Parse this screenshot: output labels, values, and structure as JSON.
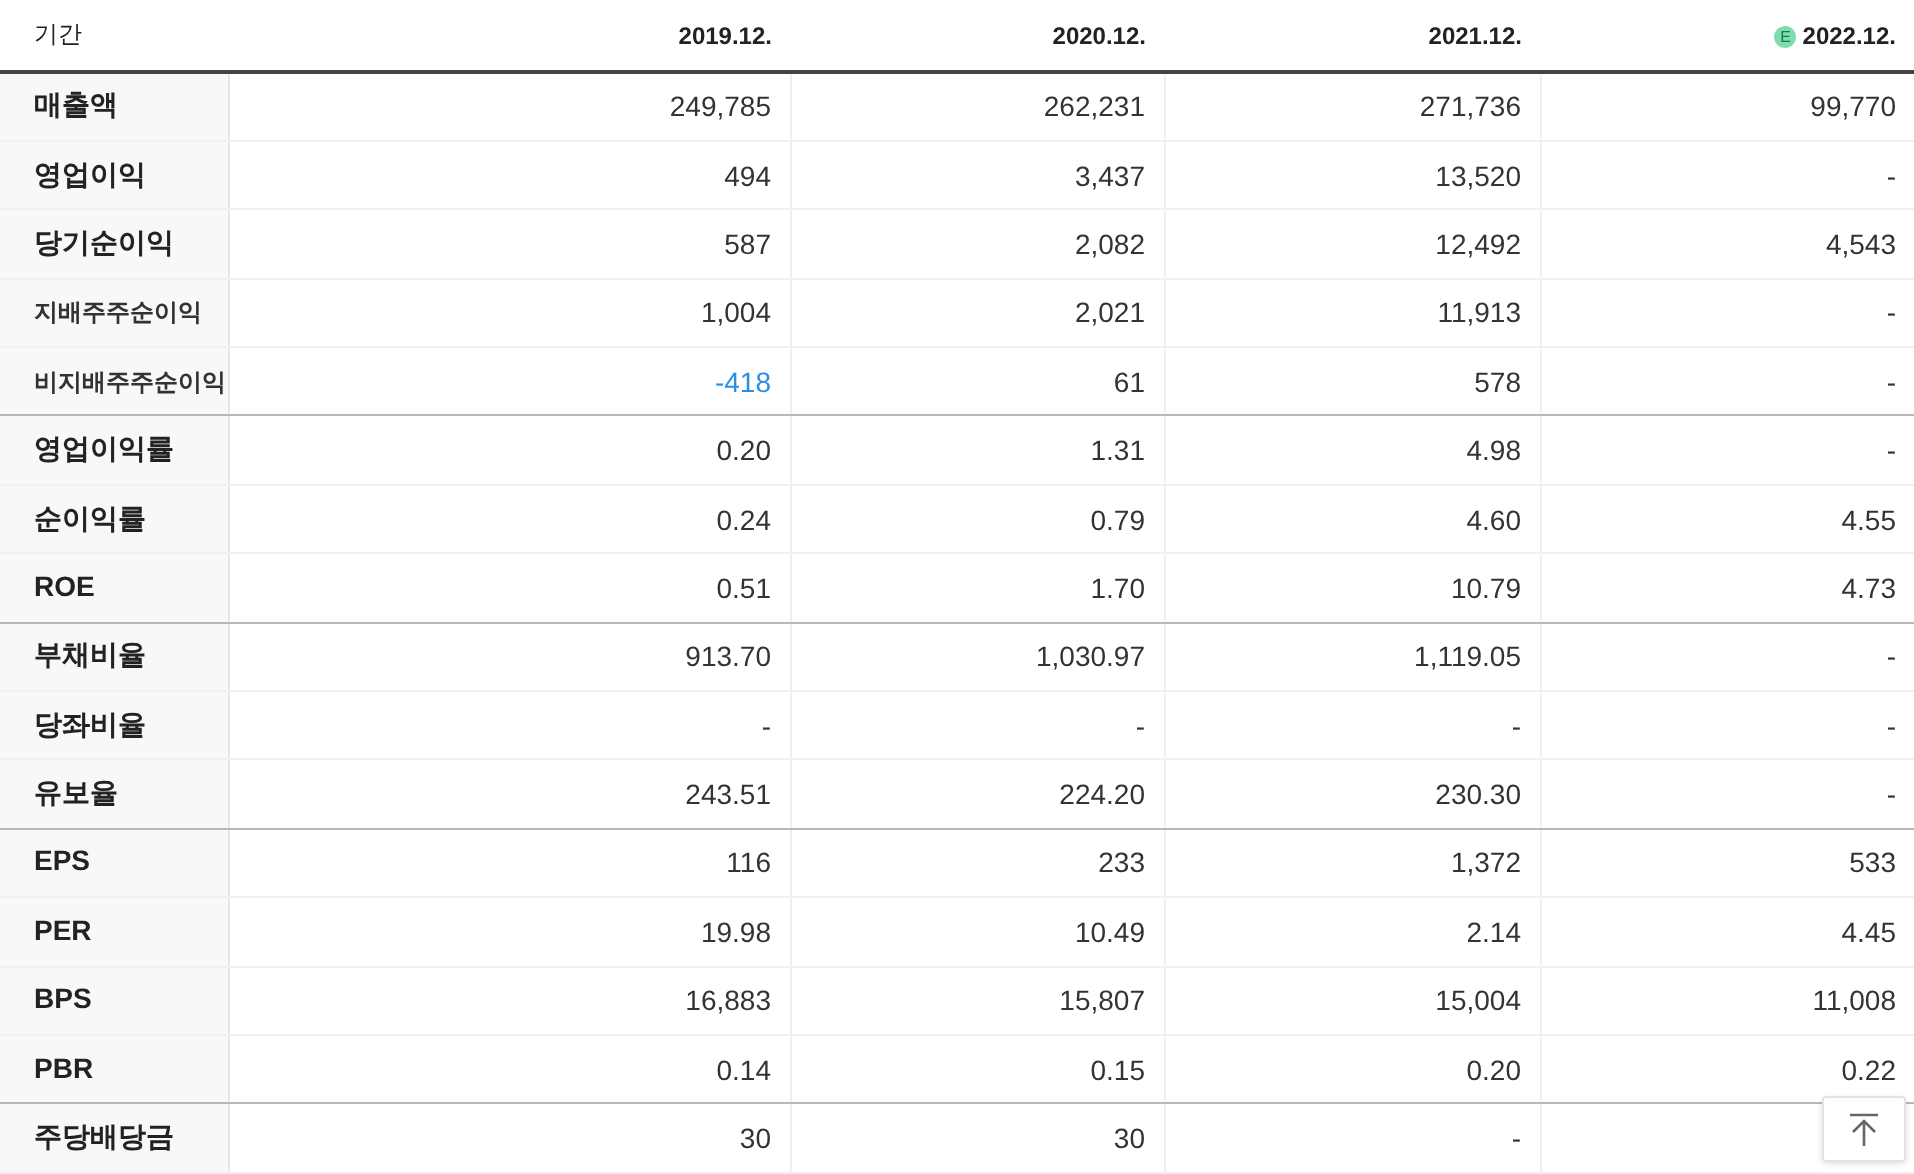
{
  "table": {
    "period_label": "기간",
    "columns": [
      {
        "label": "2019.12."
      },
      {
        "label": "2020.12."
      },
      {
        "label": "2021.12."
      },
      {
        "label": "2022.12.",
        "badge": "E"
      }
    ],
    "groups": [
      {
        "rows": [
          {
            "label": "매출액",
            "kind": "main",
            "cells": [
              {
                "text": "249,785",
                "negative": false
              },
              {
                "text": "262,231",
                "negative": false
              },
              {
                "text": "271,736",
                "negative": false
              },
              {
                "text": "99,770",
                "negative": false
              }
            ]
          },
          {
            "label": "영업이익",
            "kind": "main",
            "cells": [
              {
                "text": "494",
                "negative": false
              },
              {
                "text": "3,437",
                "negative": false
              },
              {
                "text": "13,520",
                "negative": false
              },
              {
                "text": "-",
                "negative": false
              }
            ]
          },
          {
            "label": "당기순이익",
            "kind": "main",
            "cells": [
              {
                "text": "587",
                "negative": false
              },
              {
                "text": "2,082",
                "negative": false
              },
              {
                "text": "12,492",
                "negative": false
              },
              {
                "text": "4,543",
                "negative": false
              }
            ]
          },
          {
            "label": "지배주주순이익",
            "kind": "sub",
            "cells": [
              {
                "text": "1,004",
                "negative": false
              },
              {
                "text": "2,021",
                "negative": false
              },
              {
                "text": "11,913",
                "negative": false
              },
              {
                "text": "-",
                "negative": false
              }
            ]
          },
          {
            "label": "비지배주주순이익",
            "kind": "sub",
            "cells": [
              {
                "text": "-418",
                "negative": true
              },
              {
                "text": "61",
                "negative": false
              },
              {
                "text": "578",
                "negative": false
              },
              {
                "text": "-",
                "negative": false
              }
            ]
          }
        ]
      },
      {
        "rows": [
          {
            "label": "영업이익률",
            "kind": "main",
            "cells": [
              {
                "text": "0.20",
                "negative": false
              },
              {
                "text": "1.31",
                "negative": false
              },
              {
                "text": "4.98",
                "negative": false
              },
              {
                "text": "-",
                "negative": false
              }
            ]
          },
          {
            "label": "순이익률",
            "kind": "main",
            "cells": [
              {
                "text": "0.24",
                "negative": false
              },
              {
                "text": "0.79",
                "negative": false
              },
              {
                "text": "4.60",
                "negative": false
              },
              {
                "text": "4.55",
                "negative": false
              }
            ]
          },
          {
            "label": "ROE",
            "kind": "main",
            "cells": [
              {
                "text": "0.51",
                "negative": false
              },
              {
                "text": "1.70",
                "negative": false
              },
              {
                "text": "10.79",
                "negative": false
              },
              {
                "text": "4.73",
                "negative": false
              }
            ]
          }
        ]
      },
      {
        "rows": [
          {
            "label": "부채비율",
            "kind": "main",
            "cells": [
              {
                "text": "913.70",
                "negative": false
              },
              {
                "text": "1,030.97",
                "negative": false
              },
              {
                "text": "1,119.05",
                "negative": false
              },
              {
                "text": "-",
                "negative": false
              }
            ]
          },
          {
            "label": "당좌비율",
            "kind": "main",
            "cells": [
              {
                "text": "-",
                "negative": false
              },
              {
                "text": "-",
                "negative": false
              },
              {
                "text": "-",
                "negative": false
              },
              {
                "text": "-",
                "negative": false
              }
            ]
          },
          {
            "label": "유보율",
            "kind": "main",
            "cells": [
              {
                "text": "243.51",
                "negative": false
              },
              {
                "text": "224.20",
                "negative": false
              },
              {
                "text": "230.30",
                "negative": false
              },
              {
                "text": "-",
                "negative": false
              }
            ]
          }
        ]
      },
      {
        "rows": [
          {
            "label": "EPS",
            "kind": "main",
            "cells": [
              {
                "text": "116",
                "negative": false
              },
              {
                "text": "233",
                "negative": false
              },
              {
                "text": "1,372",
                "negative": false
              },
              {
                "text": "533",
                "negative": false
              }
            ]
          },
          {
            "label": "PER",
            "kind": "main",
            "cells": [
              {
                "text": "19.98",
                "negative": false
              },
              {
                "text": "10.49",
                "negative": false
              },
              {
                "text": "2.14",
                "negative": false
              },
              {
                "text": "4.45",
                "negative": false
              }
            ]
          },
          {
            "label": "BPS",
            "kind": "main",
            "cells": [
              {
                "text": "16,883",
                "negative": false
              },
              {
                "text": "15,807",
                "negative": false
              },
              {
                "text": "15,004",
                "negative": false
              },
              {
                "text": "11,008",
                "negative": false
              }
            ]
          },
          {
            "label": "PBR",
            "kind": "main",
            "cells": [
              {
                "text": "0.14",
                "negative": false
              },
              {
                "text": "0.15",
                "negative": false
              },
              {
                "text": "0.20",
                "negative": false
              },
              {
                "text": "0.22",
                "negative": false
              }
            ]
          }
        ]
      },
      {
        "rows": [
          {
            "label": "주당배당금",
            "kind": "main",
            "cells": [
              {
                "text": "30",
                "negative": false
              },
              {
                "text": "30",
                "negative": false
              },
              {
                "text": "-",
                "negative": false
              }
            ]
          }
        ]
      }
    ]
  }
}
